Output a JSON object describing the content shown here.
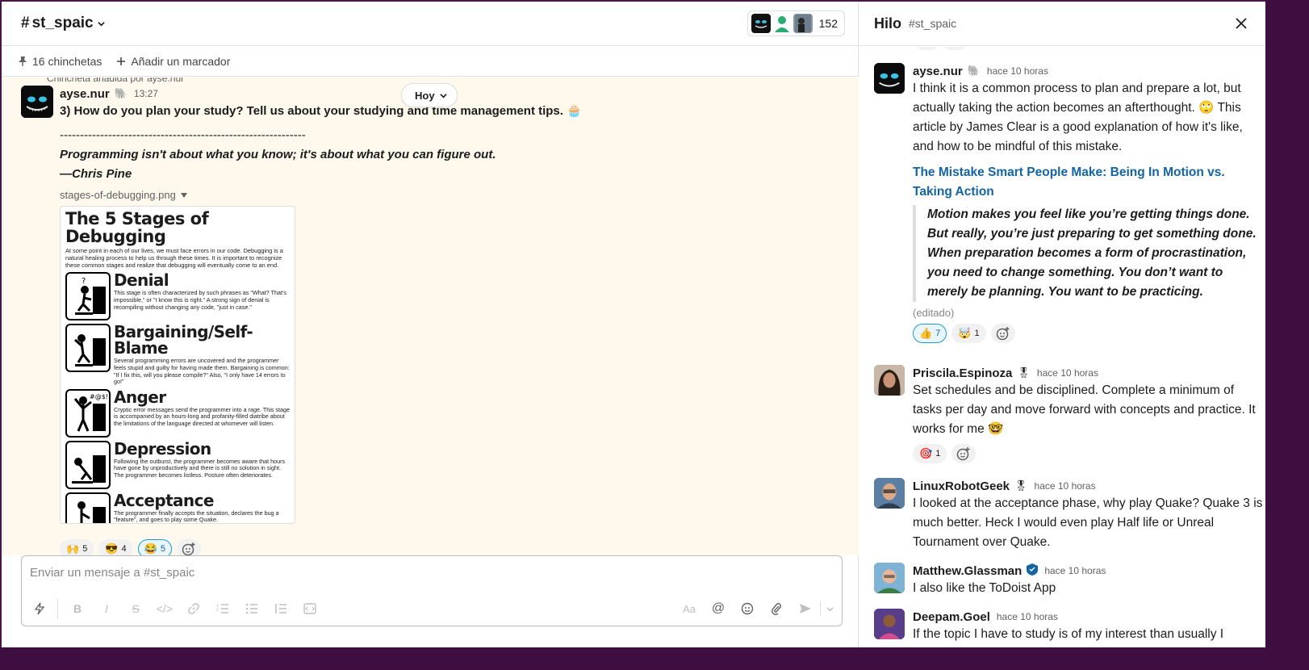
{
  "channel": {
    "name": "st_spaic",
    "member_count": "152"
  },
  "bookmarks": {
    "pins": "16 chinchetas",
    "add": "Añadir un marcador"
  },
  "today_pill": "Hoy",
  "pinned_note": "Chincheta añadida por ayse.nur",
  "main_message": {
    "user": "ayse.nur",
    "time": "13:27",
    "text": "3) How do you plan your study? Tell us about your studying and time management tips.",
    "divider": "-------------------------------------------------------------",
    "quote": "Programming isn't about what you know; it's about what you can figure out.",
    "author": "—Chris Pine",
    "file_name": "stages-of-debugging.png",
    "image": {
      "title": "The 5 Stages of Debugging",
      "intro": "At some point in each of our lives, we must face errors in our code. Debugging is a natural healing process to help us through these times. It is important to recognize these common stages and realize that debugging will eventually come to an end.",
      "stages": [
        {
          "name": "Denial",
          "desc": "This stage is often characterized by such phrases as \"What? That's impossible,\" or \"I know this is right.\" A strong sign of denial is recompiling without changing any code, \"just in case.\""
        },
        {
          "name": "Bargaining/Self-Blame",
          "desc": "Several programming errors are uncovered and the programmer feels stupid and guilty for having made them. Bargaining is common: \"If I fix this, will you please compile?\" Also, \"I only have 14 errors to go!\""
        },
        {
          "name": "Anger",
          "desc": "Cryptic error messages send the programmer into a rage. This stage is accompanied by an hours-long and profanity-filled diatribe about the limitations of the language directed at whomever will listen."
        },
        {
          "name": "Depression",
          "desc": "Following the outburst, the programmer becomes aware that hours have gone by unproductively and there is still no solution in sight. The programmer becomes listless. Posture often deteriorates."
        },
        {
          "name": "Acceptance",
          "desc": "The programmer finally accepts the situation, declares the bug a \"feature\", and goes to play some Quake."
        }
      ]
    },
    "reactions": [
      {
        "emoji": "🙌",
        "count": "5"
      },
      {
        "emoji": "😎",
        "count": "4"
      },
      {
        "emoji": "😂",
        "count": "5"
      }
    ]
  },
  "composer": {
    "placeholder": "Enviar un mensaje a #st_spaic"
  },
  "thread": {
    "title": "Hilo",
    "channel": "#st_spaic",
    "messages": [
      {
        "user": "ayse.nur",
        "time": "hace 10 horas",
        "text": "I think it is a common process to plan and prepare a lot, but actually taking the action becomes an afterthought. 🙄 This article by James Clear is a good explanation of how it's like, and how to be mindful of this mistake.",
        "link": "The Mistake Smart People Make: Being In Motion vs. Taking Action",
        "blockquote": "Motion makes you feel like you’re getting things done. But really, you’re just preparing to get something done. When preparation becomes a form of procrastination, you need to change something. You don’t want to merely be planning. You want to be practicing.",
        "edited": "(editado)",
        "reactions": [
          {
            "emoji": "👍",
            "count": "7"
          },
          {
            "emoji": "🤯",
            "count": "1"
          }
        ]
      },
      {
        "user": "Priscila.Espinoza",
        "time": "hace 10 horas",
        "text": "Set schedules and be disciplined. Complete a minimum of tasks per day and move forward with concepts and practice. It works for me 🤓",
        "reactions": [
          {
            "emoji": "🎯",
            "count": "1"
          }
        ]
      },
      {
        "user": "LinuxRobotGeek",
        "time": "hace 10 horas",
        "text": "I looked at the acceptance phase, why play Quake? Quake 3 is much better. Heck I would even play Half life or Unreal Tournament over Quake."
      },
      {
        "user": "Matthew.Glassman",
        "time": "hace 10 horas",
        "text": "I also like the ToDoist App"
      },
      {
        "user": "Deepam.Goel",
        "time": "hace 10 horas",
        "text": "If the topic I have to study is of my interest than usually I"
      }
    ]
  },
  "colors": {
    "accent": "#1264a3",
    "highlight_bg": "#fef9ec",
    "frame": "#4a154b"
  }
}
